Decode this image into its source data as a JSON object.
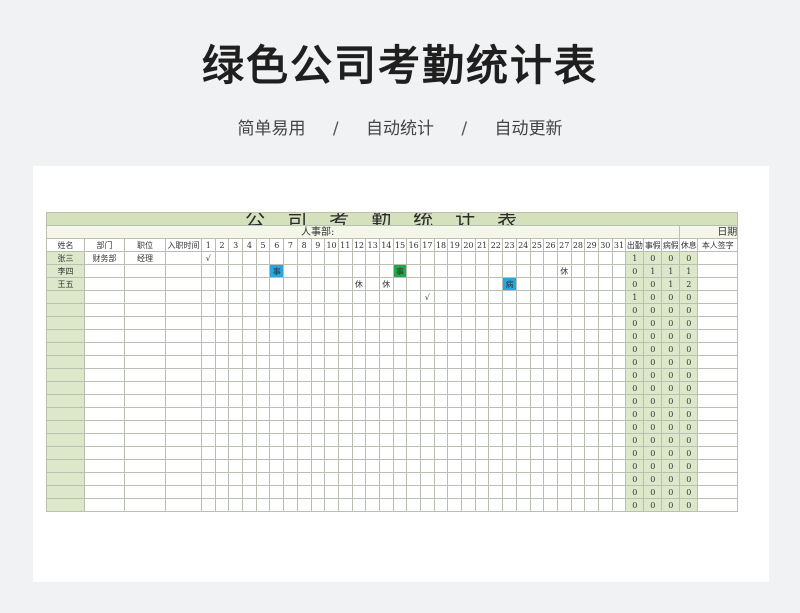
{
  "page": {
    "title": "绿色公司考勤统计表",
    "subtitle_items": [
      "简单易用",
      "自动统计",
      "自动更新"
    ],
    "subtitle_separator": "/"
  },
  "sheet": {
    "heading": "公司考勤统计表",
    "dept_label": "人事部:",
    "date_label": "日期",
    "headers": {
      "name": "姓名",
      "dept": "部门",
      "position": "职位",
      "hire_date": "入职时间",
      "days": [
        "1",
        "2",
        "3",
        "4",
        "5",
        "6",
        "7",
        "8",
        "9",
        "10",
        "11",
        "12",
        "13",
        "14",
        "15",
        "16",
        "17",
        "18",
        "19",
        "20",
        "21",
        "22",
        "23",
        "24",
        "25",
        "26",
        "27",
        "28",
        "29",
        "30",
        "31"
      ],
      "summary": [
        "出勤",
        "事假",
        "病假",
        "休息"
      ],
      "signature": "本人签字"
    },
    "rows": [
      {
        "name": "张三",
        "dept": "财务部",
        "position": "经理",
        "hire": "",
        "marks": {
          "1": "√"
        },
        "summary": [
          "1",
          "0",
          "0",
          "0"
        ]
      },
      {
        "name": "李四",
        "dept": "",
        "position": "",
        "hire": "",
        "marks": {
          "6": "事",
          "15": "事",
          "27": "休"
        },
        "summary": [
          "0",
          "1",
          "1",
          "1"
        ]
      },
      {
        "name": "王五",
        "dept": "",
        "position": "",
        "hire": "",
        "marks": {
          "12": "休",
          "14": "休",
          "23": "病"
        },
        "summary": [
          "0",
          "0",
          "1",
          "2"
        ]
      },
      {
        "name": "",
        "dept": "",
        "position": "",
        "hire": "",
        "marks": {
          "17": "√"
        },
        "summary": [
          "1",
          "0",
          "0",
          "0"
        ]
      },
      {
        "name": "",
        "dept": "",
        "position": "",
        "hire": "",
        "marks": {},
        "summary": [
          "0",
          "0",
          "0",
          "0"
        ]
      },
      {
        "name": "",
        "dept": "",
        "position": "",
        "hire": "",
        "marks": {},
        "summary": [
          "0",
          "0",
          "0",
          "0"
        ]
      },
      {
        "name": "",
        "dept": "",
        "position": "",
        "hire": "",
        "marks": {},
        "summary": [
          "0",
          "0",
          "0",
          "0"
        ]
      },
      {
        "name": "",
        "dept": "",
        "position": "",
        "hire": "",
        "marks": {},
        "summary": [
          "0",
          "0",
          "0",
          "0"
        ]
      },
      {
        "name": "",
        "dept": "",
        "position": "",
        "hire": "",
        "marks": {},
        "summary": [
          "0",
          "0",
          "0",
          "0"
        ]
      },
      {
        "name": "",
        "dept": "",
        "position": "",
        "hire": "",
        "marks": {},
        "summary": [
          "0",
          "0",
          "0",
          "0"
        ]
      },
      {
        "name": "",
        "dept": "",
        "position": "",
        "hire": "",
        "marks": {},
        "summary": [
          "0",
          "0",
          "0",
          "0"
        ]
      },
      {
        "name": "",
        "dept": "",
        "position": "",
        "hire": "",
        "marks": {},
        "summary": [
          "0",
          "0",
          "0",
          "0"
        ]
      },
      {
        "name": "",
        "dept": "",
        "position": "",
        "hire": "",
        "marks": {},
        "summary": [
          "0",
          "0",
          "0",
          "0"
        ]
      },
      {
        "name": "",
        "dept": "",
        "position": "",
        "hire": "",
        "marks": {},
        "summary": [
          "0",
          "0",
          "0",
          "0"
        ]
      },
      {
        "name": "",
        "dept": "",
        "position": "",
        "hire": "",
        "marks": {},
        "summary": [
          "0",
          "0",
          "0",
          "0"
        ]
      },
      {
        "name": "",
        "dept": "",
        "position": "",
        "hire": "",
        "marks": {},
        "summary": [
          "0",
          "0",
          "0",
          "0"
        ]
      },
      {
        "name": "",
        "dept": "",
        "position": "",
        "hire": "",
        "marks": {},
        "summary": [
          "0",
          "0",
          "0",
          "0"
        ]
      },
      {
        "name": "",
        "dept": "",
        "position": "",
        "hire": "",
        "marks": {},
        "summary": [
          "0",
          "0",
          "0",
          "0"
        ]
      },
      {
        "name": "",
        "dept": "",
        "position": "",
        "hire": "",
        "marks": {},
        "summary": [
          "0",
          "0",
          "0",
          "0"
        ]
      },
      {
        "name": "",
        "dept": "",
        "position": "",
        "hire": "",
        "marks": {},
        "summary": [
          "0",
          "0",
          "0",
          "0"
        ]
      }
    ],
    "mark_colors": {
      "事_day6": "#2aa3df",
      "事_day15": "#22a64a",
      "病": "#23a9e1"
    }
  }
}
